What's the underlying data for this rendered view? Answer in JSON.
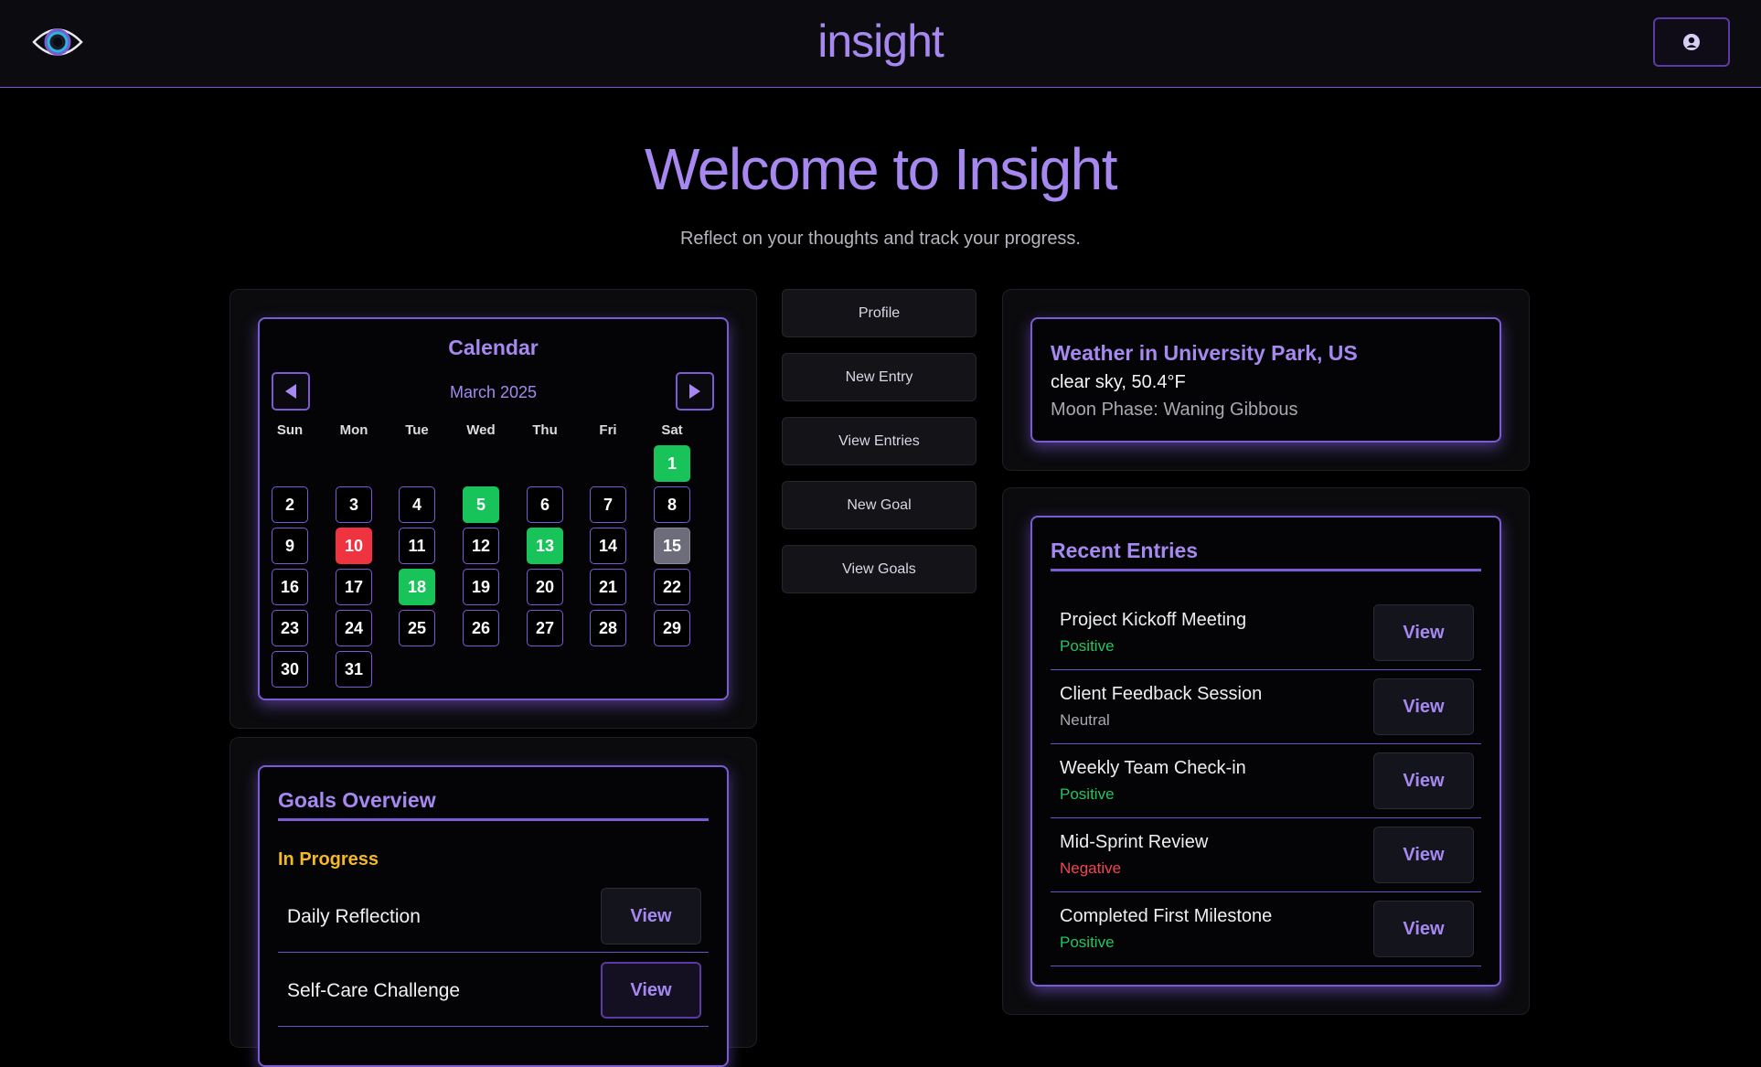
{
  "header": {
    "app_title": "insight"
  },
  "hero": {
    "title": "Welcome to Insight",
    "subtitle": "Reflect on your thoughts and track your progress."
  },
  "calendar": {
    "title": "Calendar",
    "month": "March 2025",
    "weekdays": [
      "Sun",
      "Mon",
      "Tue",
      "Wed",
      "Thu",
      "Fri",
      "Sat"
    ],
    "days": [
      "1",
      "2",
      "3",
      "4",
      "5",
      "6",
      "7",
      "8",
      "9",
      "10",
      "11",
      "12",
      "13",
      "14",
      "15",
      "16",
      "17",
      "18",
      "19",
      "20",
      "21",
      "22",
      "23",
      "24",
      "25",
      "26",
      "27",
      "28",
      "29",
      "30",
      "31"
    ],
    "colors": {
      "positive": "#18c45a",
      "negative": "#ef3340",
      "today": "#6c6c7a"
    }
  },
  "nav": {
    "profile": "Profile",
    "new_entry": "New Entry",
    "view_entries": "View Entries",
    "new_goal": "New Goal",
    "view_goals": "View Goals"
  },
  "weather": {
    "title": "Weather in University Park, US",
    "condition": "clear sky, 50.4°F",
    "moon": "Moon Phase: Waning Gibbous"
  },
  "recent_entries": {
    "title": "Recent Entries",
    "view_label": "View",
    "items": [
      {
        "title": "Project Kickoff Meeting",
        "mood": "Positive"
      },
      {
        "title": "Client Feedback Session",
        "mood": "Neutral"
      },
      {
        "title": "Weekly Team Check-in",
        "mood": "Positive"
      },
      {
        "title": "Mid-Sprint Review",
        "mood": "Negative"
      },
      {
        "title": "Completed First Milestone",
        "mood": "Positive"
      }
    ]
  },
  "goals": {
    "title": "Goals Overview",
    "section": "In Progress",
    "view_label": "View",
    "items": [
      {
        "title": "Daily Reflection"
      },
      {
        "title": "Self-Care Challenge"
      }
    ]
  },
  "theme": {
    "accent": "#a688f0",
    "border": "#7c5ad6",
    "positive": "#22c55e",
    "neutral": "#a8a8b0",
    "negative": "#f0454f",
    "in_progress": "#f5b921"
  }
}
